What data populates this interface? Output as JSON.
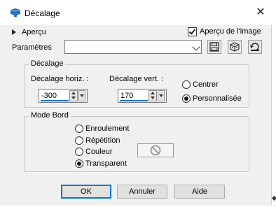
{
  "window": {
    "title": "Décalage",
    "close_glyph": "✕"
  },
  "preview": {
    "toggle_label": "Aperçu",
    "image_preview_label": "Aperçu de l'image",
    "image_preview_checked": true
  },
  "presets": {
    "label": "Paramètres",
    "value": "",
    "buttons": [
      "save-icon",
      "reset-dice-icon",
      "reset-icon"
    ]
  },
  "offset_group": {
    "title": "Décalage",
    "horizontal": {
      "label": "Décalage horiz. :",
      "value": "-300"
    },
    "vertical": {
      "label": "Décalage vert. :",
      "value": "170"
    },
    "mode_options": [
      {
        "label": "Centrer",
        "selected": false
      },
      {
        "label": "Personnalisée",
        "selected": true
      }
    ]
  },
  "edge_group": {
    "title": "Mode Bord",
    "options": [
      {
        "label": "Enroulement",
        "selected": false
      },
      {
        "label": "Répétition",
        "selected": false
      },
      {
        "label": "Couleur",
        "selected": false
      },
      {
        "label": "Transparent",
        "selected": true
      }
    ],
    "color_swatch_icon": "no-color-icon"
  },
  "footer": {
    "ok": "OK",
    "cancel": "Annuler",
    "help": "Aide"
  }
}
